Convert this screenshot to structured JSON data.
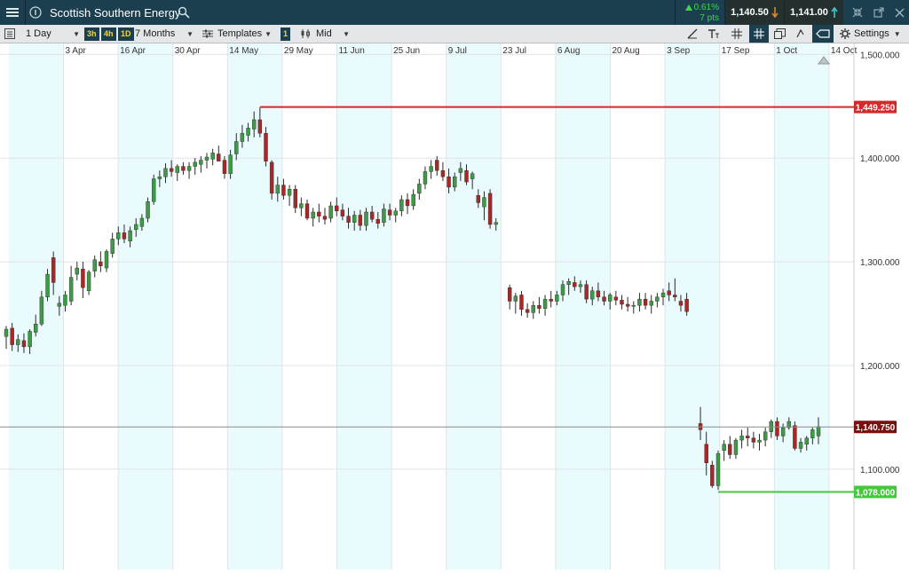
{
  "titlebar": {
    "instrument": "Scottish Southern Energy",
    "change_pct": "0.61%",
    "change_pts": "7 pts",
    "sell_price": "1,140.50",
    "buy_price": "1,141.00"
  },
  "toolbar": {
    "timeframe": "1 Day",
    "quick_3h": "3h",
    "quick_4h": "4h",
    "quick_1d": "1D",
    "range": "7 Months",
    "templates": "Templates",
    "count": "1",
    "price_mode": "Mid",
    "settings": "Settings"
  },
  "chart_data": {
    "type": "candlestick",
    "x_labels": [
      "3 Apr",
      "16 Apr",
      "30 Apr",
      "14 May",
      "29 May",
      "11 Jun",
      "25 Jun",
      "9 Jul",
      "23 Jul",
      "6 Aug",
      "20 Aug",
      "3 Sep",
      "17 Sep",
      "1 Oct",
      "14 Oct"
    ],
    "y_ticks": [
      "1,100.000",
      "1,200.000",
      "1,300.000",
      "1,400.000",
      "1,500.000"
    ],
    "ylim": [
      1010,
      1502
    ],
    "markers": {
      "high": {
        "label": "1,449.250",
        "value": 1449.25,
        "color": "#d42a2a"
      },
      "current": {
        "label": "1,140.750",
        "value": 1140.75,
        "color": "#7a0f0f"
      },
      "low": {
        "label": "1,078.000",
        "value": 1078.0,
        "color": "#43c93a"
      }
    },
    "colors": {
      "up": "#3d9b46",
      "down": "#a82828",
      "band": "#e9fbfd",
      "grid": "#dfe4e8"
    },
    "candles": [
      [
        1228,
        1238,
        1216,
        1235
      ],
      [
        1236,
        1241,
        1214,
        1220
      ],
      [
        1220,
        1230,
        1213,
        1225
      ],
      [
        1224,
        1231,
        1212,
        1218
      ],
      [
        1218,
        1235,
        1211,
        1233
      ],
      [
        1232,
        1249,
        1228,
        1240
      ],
      [
        1240,
        1272,
        1238,
        1266
      ],
      [
        1266,
        1293,
        1262,
        1288
      ],
      [
        1304,
        1310,
        1268,
        1280
      ],
      [
        1257,
        1267,
        1248,
        1260
      ],
      [
        1258,
        1272,
        1252,
        1268
      ],
      [
        1262,
        1296,
        1258,
        1285
      ],
      [
        1288,
        1300,
        1282,
        1294
      ],
      [
        1293,
        1300,
        1265,
        1275
      ],
      [
        1272,
        1292,
        1268,
        1290
      ],
      [
        1291,
        1306,
        1285,
        1302
      ],
      [
        1300,
        1310,
        1290,
        1296
      ],
      [
        1294,
        1312,
        1290,
        1310
      ],
      [
        1308,
        1328,
        1304,
        1322
      ],
      [
        1322,
        1334,
        1316,
        1328
      ],
      [
        1328,
        1336,
        1318,
        1322
      ],
      [
        1320,
        1334,
        1314,
        1330
      ],
      [
        1331,
        1342,
        1324,
        1336
      ],
      [
        1334,
        1346,
        1330,
        1342
      ],
      [
        1342,
        1362,
        1338,
        1358
      ],
      [
        1358,
        1384,
        1355,
        1380
      ],
      [
        1380,
        1388,
        1372,
        1382
      ],
      [
        1382,
        1395,
        1376,
        1390
      ],
      [
        1390,
        1398,
        1382,
        1387
      ],
      [
        1386,
        1394,
        1378,
        1392
      ],
      [
        1392,
        1396,
        1384,
        1388
      ],
      [
        1388,
        1396,
        1380,
        1392
      ],
      [
        1392,
        1400,
        1384,
        1396
      ],
      [
        1394,
        1402,
        1386,
        1398
      ],
      [
        1398,
        1405,
        1390,
        1401
      ],
      [
        1399,
        1409,
        1393,
        1405
      ],
      [
        1404,
        1412,
        1398,
        1397
      ],
      [
        1398,
        1402,
        1380,
        1385
      ],
      [
        1385,
        1408,
        1380,
        1403
      ],
      [
        1404,
        1424,
        1398,
        1416
      ],
      [
        1416,
        1432,
        1410,
        1424
      ],
      [
        1422,
        1434,
        1416,
        1429
      ],
      [
        1428,
        1445,
        1420,
        1437
      ],
      [
        1437,
        1449,
        1420,
        1424
      ],
      [
        1424,
        1430,
        1392,
        1397
      ],
      [
        1396,
        1398,
        1360,
        1366
      ],
      [
        1366,
        1382,
        1358,
        1374
      ],
      [
        1374,
        1380,
        1360,
        1364
      ],
      [
        1364,
        1374,
        1354,
        1370
      ],
      [
        1370,
        1374,
        1347,
        1352
      ],
      [
        1352,
        1362,
        1344,
        1356
      ],
      [
        1356,
        1360,
        1340,
        1342
      ],
      [
        1342,
        1352,
        1334,
        1348
      ],
      [
        1348,
        1356,
        1338,
        1344
      ],
      [
        1344,
        1352,
        1336,
        1341
      ],
      [
        1342,
        1358,
        1338,
        1354
      ],
      [
        1354,
        1362,
        1344,
        1349
      ],
      [
        1350,
        1356,
        1340,
        1344
      ],
      [
        1344,
        1352,
        1332,
        1338
      ],
      [
        1338,
        1349,
        1330,
        1345
      ],
      [
        1345,
        1350,
        1330,
        1335
      ],
      [
        1335,
        1352,
        1330,
        1348
      ],
      [
        1348,
        1354,
        1338,
        1341
      ],
      [
        1341,
        1348,
        1332,
        1337
      ],
      [
        1338,
        1356,
        1334,
        1351
      ],
      [
        1350,
        1356,
        1340,
        1345
      ],
      [
        1345,
        1352,
        1338,
        1349
      ],
      [
        1349,
        1364,
        1344,
        1360
      ],
      [
        1360,
        1366,
        1346,
        1354
      ],
      [
        1354,
        1370,
        1350,
        1365
      ],
      [
        1366,
        1380,
        1360,
        1375
      ],
      [
        1375,
        1392,
        1370,
        1387
      ],
      [
        1387,
        1398,
        1380,
        1392
      ],
      [
        1398,
        1402,
        1383,
        1388
      ],
      [
        1388,
        1396,
        1378,
        1382
      ],
      [
        1382,
        1390,
        1366,
        1372
      ],
      [
        1372,
        1386,
        1368,
        1382
      ],
      [
        1386,
        1396,
        1378,
        1390
      ],
      [
        1388,
        1394,
        1374,
        1377
      ],
      [
        1380,
        1387,
        1370,
        1385
      ],
      [
        1364,
        1370,
        1352,
        1357
      ],
      [
        1353,
        1368,
        1340,
        1362
      ],
      [
        1366,
        1370,
        1332,
        1336
      ],
      [
        1336,
        1342,
        1330,
        1338
      ],
      [
        1275,
        1278,
        1254,
        1262
      ],
      [
        1262,
        1270,
        1250,
        1267
      ],
      [
        1268,
        1272,
        1248,
        1254
      ],
      [
        1254,
        1260,
        1246,
        1251
      ],
      [
        1251,
        1262,
        1245,
        1258
      ],
      [
        1258,
        1266,
        1250,
        1255
      ],
      [
        1255,
        1268,
        1248,
        1264
      ],
      [
        1264,
        1272,
        1256,
        1262
      ],
      [
        1262,
        1272,
        1258,
        1268
      ],
      [
        1268,
        1282,
        1262,
        1278
      ],
      [
        1278,
        1284,
        1268,
        1281
      ],
      [
        1280,
        1286,
        1272,
        1276
      ],
      [
        1276,
        1282,
        1270,
        1278
      ],
      [
        1278,
        1282,
        1260,
        1264
      ],
      [
        1264,
        1276,
        1258,
        1272
      ],
      [
        1272,
        1280,
        1262,
        1266
      ],
      [
        1266,
        1272,
        1258,
        1262
      ],
      [
        1262,
        1270,
        1254,
        1268
      ],
      [
        1266,
        1272,
        1258,
        1263
      ],
      [
        1263,
        1268,
        1254,
        1259
      ],
      [
        1259,
        1266,
        1252,
        1257
      ],
      [
        1257,
        1262,
        1250,
        1258
      ],
      [
        1258,
        1270,
        1252,
        1264
      ],
      [
        1264,
        1270,
        1254,
        1258
      ],
      [
        1258,
        1268,
        1250,
        1262
      ],
      [
        1262,
        1270,
        1256,
        1266
      ],
      [
        1266,
        1274,
        1258,
        1270
      ],
      [
        1272,
        1280,
        1262,
        1268
      ],
      [
        1268,
        1284,
        1262,
        1266
      ],
      [
        1262,
        1268,
        1252,
        1258
      ],
      [
        1264,
        1270,
        1248,
        1252
      ],
      [
        1144,
        1160,
        1128,
        1138
      ],
      [
        1124,
        1136,
        1094,
        1106
      ],
      [
        1104,
        1108,
        1082,
        1084
      ],
      [
        1084,
        1118,
        1080,
        1115
      ],
      [
        1118,
        1128,
        1108,
        1124
      ],
      [
        1124,
        1132,
        1110,
        1114
      ],
      [
        1114,
        1130,
        1110,
        1128
      ],
      [
        1128,
        1138,
        1120,
        1132
      ],
      [
        1132,
        1140,
        1122,
        1130
      ],
      [
        1130,
        1136,
        1120,
        1126
      ],
      [
        1126,
        1134,
        1118,
        1128
      ],
      [
        1128,
        1140,
        1122,
        1136
      ],
      [
        1136,
        1148,
        1130,
        1146
      ],
      [
        1146,
        1150,
        1128,
        1132
      ],
      [
        1132,
        1144,
        1126,
        1140
      ],
      [
        1140,
        1150,
        1138,
        1146
      ],
      [
        1142,
        1146,
        1118,
        1120
      ],
      [
        1120,
        1130,
        1116,
        1126
      ],
      [
        1124,
        1132,
        1118,
        1130
      ],
      [
        1130,
        1140,
        1124,
        1138
      ],
      [
        1132,
        1150,
        1124,
        1141
      ]
    ],
    "gaps_after_index": [
      83,
      114
    ]
  }
}
